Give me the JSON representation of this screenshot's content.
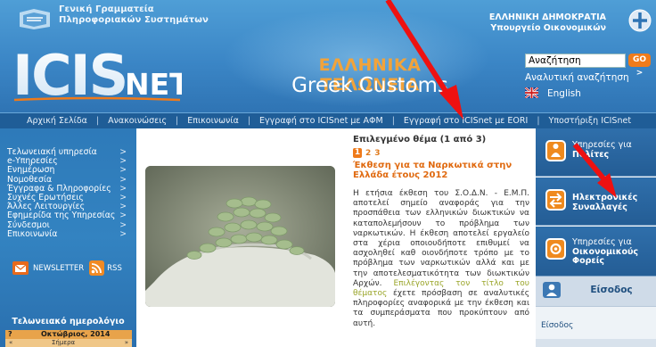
{
  "header": {
    "gsis_line1": "Γενική Γραμματεία",
    "gsis_line2": "Πληροφοριακών Συστημάτων",
    "logo_text": "ICISNET",
    "title_greek": "ΕΛΛΗΝΙΚΑ ΤΕΛΩΝΕΙΑ",
    "title_english": "Greek Customs",
    "gov_line1": "ΕΛΛΗΝΙΚΗ ΔΗΜΟΚΡΑΤΙΑ",
    "gov_line2": "Υπουργείο Οικονομικών",
    "search_value": "Αναζήτηση",
    "search_button": "GO >",
    "advanced_search": "Αναλυτική αναζήτηση",
    "language": "English"
  },
  "nav": {
    "items": [
      "Αρχική Σελίδα",
      "Ανακοινώσεις",
      "Επικοινωνία",
      "Εγγραφή στο ICISnet με ΑΦΜ",
      "Εγγραφή στο ICISnet με EORI",
      "Υποστήριξη ICISnet"
    ],
    "separator": "|"
  },
  "sidebar": {
    "items": [
      "Τελωνειακή υπηρεσία",
      "e-Υπηρεσίες",
      "Ενημέρωση",
      "Νομοθεσία",
      "Έγγραφα & Πληροφορίες",
      "Συχνές Ερωτήσεις",
      "Άλλες Λειτουργίες",
      "Εφημερίδα της Υπηρεσίας",
      "Σύνδεσμοι",
      "Επικοινωνία"
    ],
    "arrow": ">",
    "newsletter": "NEWSLETTER",
    "rss": "RSS",
    "calendar_title": "Τελωνειακό ημερολόγιο",
    "calendar_nav_left": "?",
    "calendar_month": "Οκτώβριος, 2014",
    "calendar_prev": "«",
    "calendar_week": "Σήμερα",
    "calendar_next": "»"
  },
  "featured": {
    "heading": "Επιλεγμένο θέμα (1 από 3)",
    "pages": [
      "1",
      "2",
      "3"
    ],
    "active_page": "1",
    "title": "Έκθεση για τα Ναρκωτικά στην Ελλάδα έτους 2012",
    "body": "Η ετήσια έκθεση του Σ.Ο.Δ.Ν. - Ε.Μ.Π. αποτελεί σημείο αναφοράς για την προσπάθεια των ελληνικών διωκτικών να καταπολεμήσουν το πρόβλημα των ναρκωτικών. Η έκθεση αποτελεί εργαλείο στα χέρια οποιουδήποτε επιθυμεί να ασχοληθεί καθ οιονδήποτε τρόπο με το πρόβλημα των ναρκωτικών αλλά και με την αποτελεσματικότητα των διωκτικών Αρχών.",
    "link_text": "Επιλέγοντας τον τίτλο του θέματος",
    "body_after_link": " έχετε πρόσβαση σε αναλυτικές πληροφορίες αναφορικά με την έκθεση και τα συμπεράσματα που προκύπτουν από αυτή."
  },
  "services": {
    "citizens_line1": "Υπηρεσίες για",
    "citizens_line2": "Πολίτες",
    "electronic_line1": "Ηλεκτρονικές",
    "electronic_line2": "Συναλλαγές",
    "business_line1": "Υπηρεσίες για",
    "business_line2": "Οικονομικούς",
    "business_line3": "Φορείς"
  },
  "login": {
    "title": "Είσοδος",
    "link": "Είσοδος"
  },
  "colors": {
    "accent_orange": "#ef7a1a",
    "header_blue": "#3b86c6",
    "nav_blue": "#1f5d97",
    "annotation_red": "#ee1111"
  }
}
